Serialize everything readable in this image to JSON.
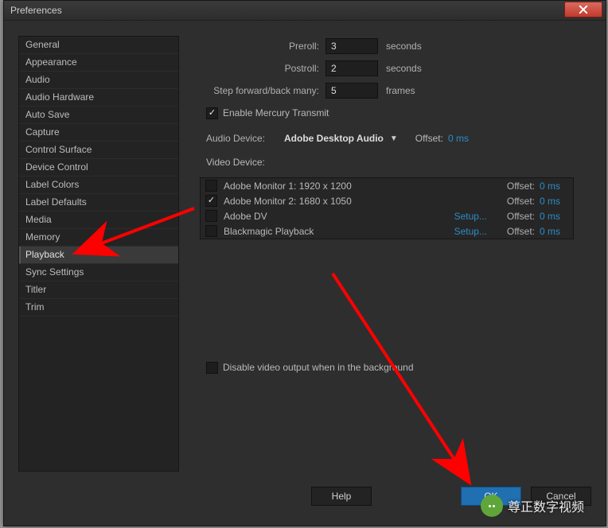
{
  "window": {
    "title": "Preferences"
  },
  "sidebar": {
    "selected_index": 12,
    "items": [
      {
        "label": "General"
      },
      {
        "label": "Appearance"
      },
      {
        "label": "Audio"
      },
      {
        "label": "Audio Hardware"
      },
      {
        "label": "Auto Save"
      },
      {
        "label": "Capture"
      },
      {
        "label": "Control Surface"
      },
      {
        "label": "Device Control"
      },
      {
        "label": "Label Colors"
      },
      {
        "label": "Label Defaults"
      },
      {
        "label": "Media"
      },
      {
        "label": "Memory"
      },
      {
        "label": "Playback"
      },
      {
        "label": "Sync Settings"
      },
      {
        "label": "Titler"
      },
      {
        "label": "Trim"
      }
    ]
  },
  "form": {
    "preroll_label": "Preroll:",
    "preroll_value": "3",
    "postroll_label": "Postroll:",
    "postroll_value": "2",
    "step_label": "Step forward/back many:",
    "step_value": "5",
    "seconds": "seconds",
    "frames": "frames",
    "mercury_checked": true,
    "mercury_label": "Enable Mercury Transmit",
    "audio_device_label": "Audio Device:",
    "audio_device_value": "Adobe Desktop Audio",
    "audio_offset_label": "Offset:",
    "audio_offset_value": "0 ms",
    "video_device_label": "Video Device:",
    "offset_label": "Offset:",
    "setup_label": "Setup...",
    "devices": [
      {
        "checked": false,
        "name": "Adobe Monitor 1: 1920 x 1200",
        "setup": false,
        "offset": "0 ms"
      },
      {
        "checked": true,
        "name": "Adobe Monitor 2: 1680 x 1050",
        "setup": false,
        "offset": "0 ms"
      },
      {
        "checked": false,
        "name": "Adobe DV",
        "setup": true,
        "offset": "0 ms"
      },
      {
        "checked": false,
        "name": "Blackmagic Playback",
        "setup": true,
        "offset": "0 ms"
      }
    ],
    "disable_bg_checked": false,
    "disable_bg_label": "Disable video output when in the background"
  },
  "footer": {
    "help": "Help",
    "ok": "OK",
    "cancel": "Cancel"
  },
  "watermark": "尊正数字视频"
}
